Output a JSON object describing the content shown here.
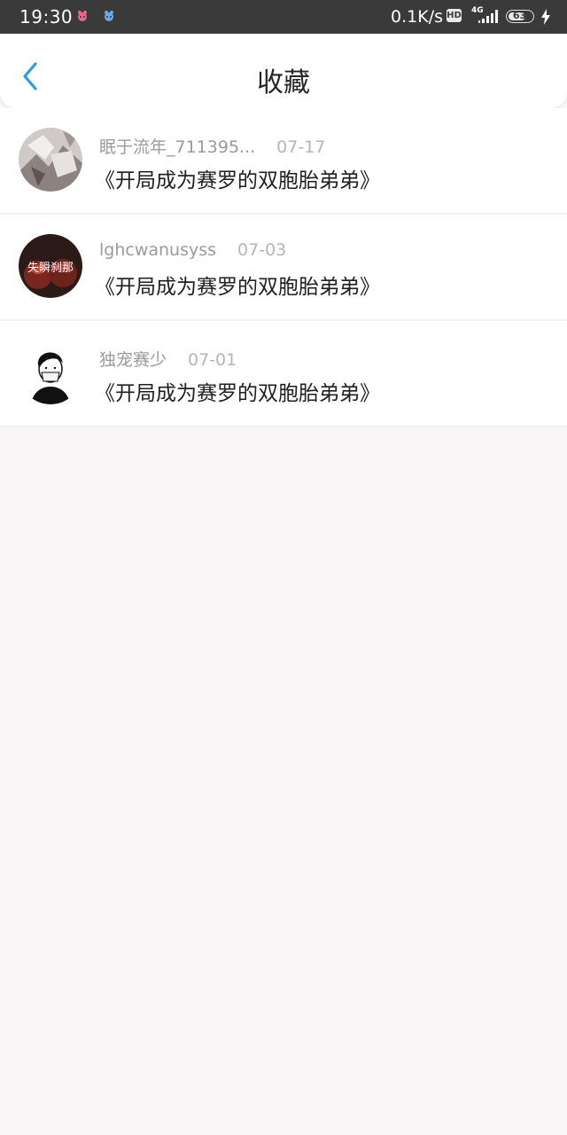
{
  "status_bar": {
    "time": "19:30",
    "net_speed": "0.1K/s",
    "hd_label": "HD",
    "network_label": "4G",
    "battery_level": "63"
  },
  "header": {
    "title": "收藏",
    "back_icon": "chevron-left-icon",
    "accent_color": "#2a9fe0"
  },
  "favorites": [
    {
      "username": "眠于流年_711395...",
      "date": "07-17",
      "book_title": "《开局成为赛罗的双胞胎弟弟》"
    },
    {
      "username": "lghcwanusyss",
      "date": "07-03",
      "book_title": "《开局成为赛罗的双胞胎弟弟》",
      "avatar_text": "失瞬刹那"
    },
    {
      "username": "独宠赛少",
      "date": "07-01",
      "book_title": "《开局成为赛罗的双胞胎弟弟》"
    }
  ]
}
